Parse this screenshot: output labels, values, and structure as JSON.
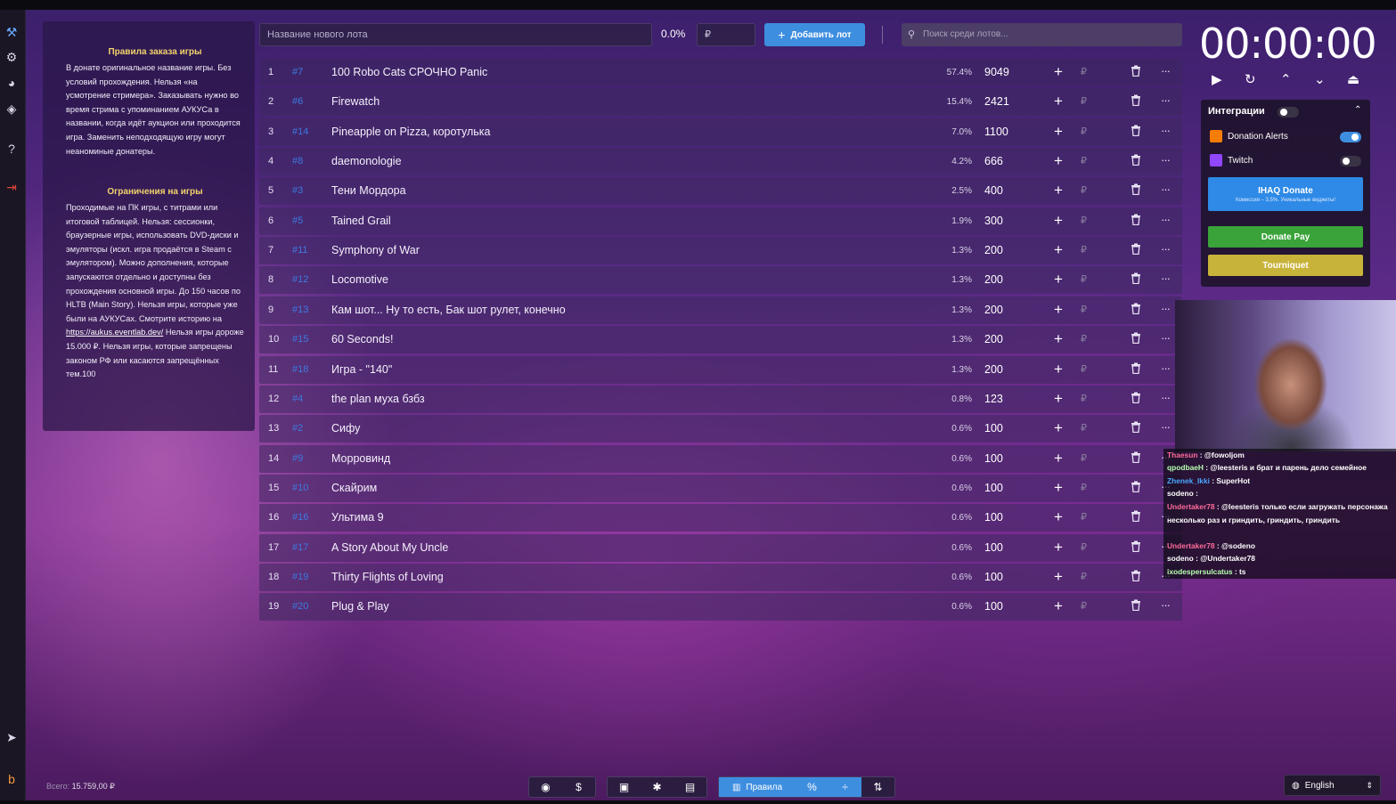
{
  "timer": {
    "display": "00:00:00"
  },
  "rules": {
    "title1": "Правила заказа игры",
    "text1": "В донате оригинальное название игры. Без условий прохождения. Нельзя «на усмотрение стримера». Заказывать нужно во время стрима с упоминанием АУКУСа в названии, когда идёт аукцион или проходится игра. Заменить неподходящую игру могут неаноминые донатеры.",
    "title2": "Ограничения на игры",
    "text2a": "Проходимые на ПК игры, с титрами или итоговой таблицей. Нельзя: сессионки, браузерные игры, использовать DVD-диски и эмуляторы (искл. игра продаётся в Steam с эмулятором). Можно дополнения, которые запускаются отдельно и доступны без прохождения основной игры. До 150 часов по HLTB (Main Story). Нельзя игры, которые уже были на АУКУСах. Смотрите историю на",
    "link": "https://aukus.eventlab.dev/",
    "text2b": "Нельзя игры дороже 15.000 ₽. Нельзя игры, которые запрещены законом РФ или касаются запрещённых тем.100"
  },
  "toolbar": {
    "new_lot_placeholder": "Название нового лота",
    "percent": "0.0%",
    "price_placeholder": "₽",
    "add_label": "Добавить лот",
    "search_placeholder": "Поиск среди лотов..."
  },
  "lots": [
    {
      "num": "1",
      "id": "#7",
      "title": "100 Robo Cats СРОЧНО Panic",
      "percent": "57.4%",
      "amount": "9049"
    },
    {
      "num": "2",
      "id": "#6",
      "title": "Firewatch",
      "percent": "15.4%",
      "amount": "2421"
    },
    {
      "num": "3",
      "id": "#14",
      "title": "Pineapple on Pizza, коротулька",
      "percent": "7.0%",
      "amount": "1100"
    },
    {
      "num": "4",
      "id": "#8",
      "title": "daemonologie",
      "percent": "4.2%",
      "amount": "666"
    },
    {
      "num": "5",
      "id": "#3",
      "title": "Тени Мордора",
      "percent": "2.5%",
      "amount": "400"
    },
    {
      "num": "6",
      "id": "#5",
      "title": "Tained Grail",
      "percent": "1.9%",
      "amount": "300"
    },
    {
      "num": "7",
      "id": "#11",
      "title": "Symphony of War",
      "percent": "1.3%",
      "amount": "200"
    },
    {
      "num": "8",
      "id": "#12",
      "title": "Locomotive",
      "percent": "1.3%",
      "amount": "200"
    },
    {
      "num": "9",
      "id": "#13",
      "title": "Кам шот... Ну то есть, Бак шот рулет, конечно",
      "percent": "1.3%",
      "amount": "200"
    },
    {
      "num": "10",
      "id": "#15",
      "title": "60 Seconds!",
      "percent": "1.3%",
      "amount": "200"
    },
    {
      "num": "11",
      "id": "#18",
      "title": "Игра - \"140\"",
      "percent": "1.3%",
      "amount": "200"
    },
    {
      "num": "12",
      "id": "#4",
      "title": "the plan муха бзбз",
      "percent": "0.8%",
      "amount": "123"
    },
    {
      "num": "13",
      "id": "#2",
      "title": "Сифу",
      "percent": "0.6%",
      "amount": "100"
    },
    {
      "num": "14",
      "id": "#9",
      "title": "Морровинд",
      "percent": "0.6%",
      "amount": "100"
    },
    {
      "num": "15",
      "id": "#10",
      "title": "Скайрим",
      "percent": "0.6%",
      "amount": "100"
    },
    {
      "num": "16",
      "id": "#16",
      "title": "Ультима 9",
      "percent": "0.6%",
      "amount": "100"
    },
    {
      "num": "17",
      "id": "#17",
      "title": "A Story About My Uncle",
      "percent": "0.6%",
      "amount": "100"
    },
    {
      "num": "18",
      "id": "#19",
      "title": "Thirty Flights of Loving",
      "percent": "0.6%",
      "amount": "100"
    },
    {
      "num": "19",
      "id": "#20",
      "title": "Plug & Play",
      "percent": "0.6%",
      "amount": "100"
    }
  ],
  "lot_currency": "₽",
  "lot_more": "···",
  "integrations": {
    "title": "Интеграции",
    "donation_alerts": "Donation Alerts",
    "twitch": "Twitch",
    "ihaq": "IHAQ Donate",
    "ihaq_sub": "Комиссия – 3,5%. Уникальные виджеты!",
    "donatepay": "Donate Pay",
    "tourniquet": "Tourniquet"
  },
  "chat": [
    {
      "user": "Thaesun",
      "text": "@fowoljom"
    },
    {
      "user": "qpodbaeH",
      "text": "@leesteris и брат и парень дело семейное"
    },
    {
      "user": "Zhenek_Ikki",
      "text": "SuperHot"
    },
    {
      "user": "sodeno",
      "text": ""
    },
    {
      "user": "Undertaker78",
      "text": "@leesteris только если загружать персонажа несколько раз и гриндить, гриндить, гриндить"
    },
    {
      "user": "Undertaker78",
      "text": "@sodeno"
    },
    {
      "user": "sodeno",
      "text": "@Undertaker78"
    },
    {
      "user": "ixodespersulcatus",
      "text": "ts"
    }
  ],
  "bottom": {
    "total_label": "Всего:",
    "total_value": "15.759,00 ₽",
    "rules_label": "Правила",
    "percent_symbol": "%",
    "language": "English"
  }
}
